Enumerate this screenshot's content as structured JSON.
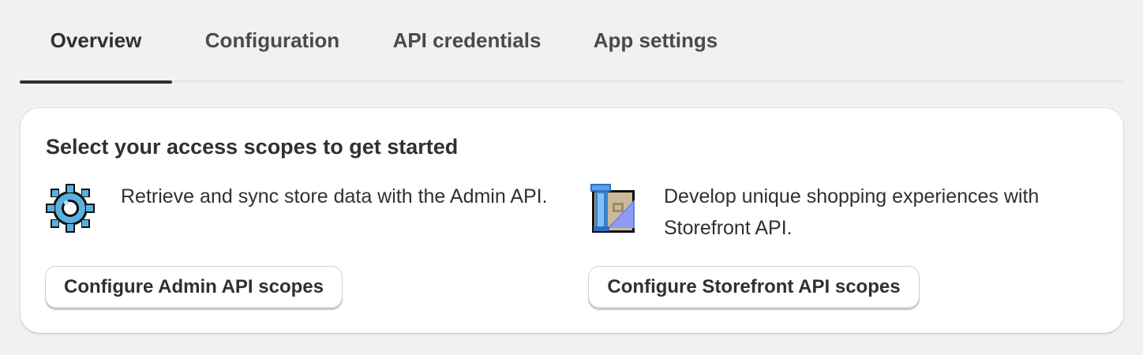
{
  "tabs": [
    {
      "label": "Overview",
      "active": true
    },
    {
      "label": "Configuration",
      "active": false
    },
    {
      "label": "API credentials",
      "active": false
    },
    {
      "label": "App settings",
      "active": false
    }
  ],
  "card": {
    "title": "Select your access scopes to get started",
    "admin": {
      "icon": "gear-icon",
      "description": "Retrieve and sync store data with the Admin API.",
      "button_label": "Configure Admin API scopes"
    },
    "storefront": {
      "icon": "storefront-scroll-icon",
      "description": "Develop unique shopping experiences with Storefront API.",
      "button_label": "Configure Storefront API scopes"
    }
  },
  "colors": {
    "background": "#f1f1f1",
    "card": "#ffffff",
    "text": "#303030",
    "tab_indicator": "#303030",
    "icon_blue": "#4aa3d8"
  }
}
